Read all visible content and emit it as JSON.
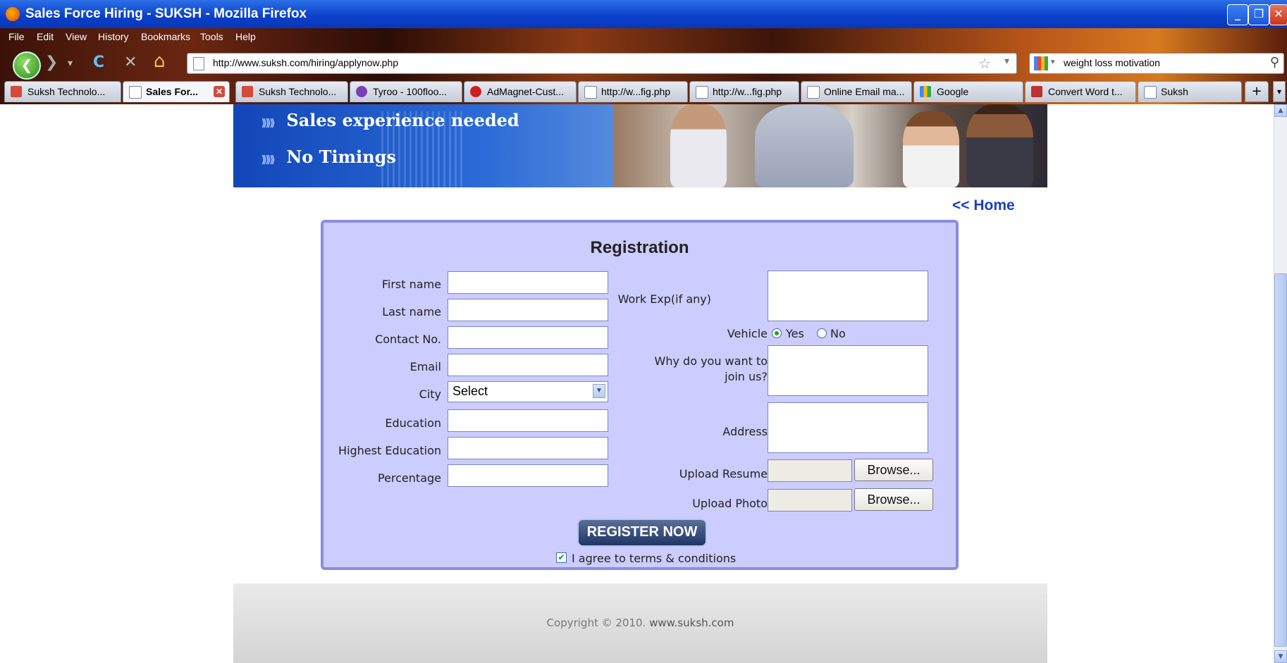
{
  "window": {
    "title": "Sales Force Hiring - SUKSH - Mozilla Firefox",
    "buttons": {
      "minimize": "_",
      "maximize": "❐",
      "close": "✕"
    }
  },
  "menubar": [
    "File",
    "Edit",
    "View",
    "History",
    "Bookmarks",
    "Tools",
    "Help"
  ],
  "toolbar": {
    "url": "http://www.suksh.com/hiring/applynow.php",
    "search_text": "weight loss motivation",
    "back_icon": "back-arrow-icon",
    "reload_glyph": "C",
    "stop_glyph": "✕",
    "home_glyph": "⌂"
  },
  "tabs": [
    {
      "label": "Suksh Technolo...",
      "icon": "gmail-icon",
      "color": "#d44b3a"
    },
    {
      "label": "Sales For...",
      "icon": "page-icon",
      "color": "#ffffff",
      "active": true
    },
    {
      "label": "Suksh Technolo...",
      "icon": "gmail-icon",
      "color": "#d44b3a"
    },
    {
      "label": "Tyroo - 100floo...",
      "icon": "tyroo-icon",
      "color": "#7a3fb5"
    },
    {
      "label": "AdMagnet-Cust...",
      "icon": "admagnet-icon",
      "color": "#cc2020"
    },
    {
      "label": "http://w...fig.php",
      "icon": "page-icon",
      "color": "#ffffff"
    },
    {
      "label": "http://w...fig.php",
      "icon": "page-icon",
      "color": "#ffffff"
    },
    {
      "label": "Online Email ma...",
      "icon": "page-icon",
      "color": "#ffffff"
    },
    {
      "label": "Google",
      "icon": "google-icon",
      "color": "#4285f4"
    },
    {
      "label": "Convert Word t...",
      "icon": "convert-icon",
      "color": "#c03030"
    },
    {
      "label": "Suksh",
      "icon": "page-icon",
      "color": "#ffffff"
    }
  ],
  "new_tab_label": "+",
  "tab_dropdown_label": "▾",
  "banner": {
    "line1": "Sales experience needed",
    "line2": "No Timings",
    "chevron": "⟫⟫⟫"
  },
  "home_link": "<< Home",
  "form": {
    "title": "Registration",
    "left_fields": [
      {
        "label": "First name",
        "type": "text",
        "value": ""
      },
      {
        "label": "Last name",
        "type": "text",
        "value": ""
      },
      {
        "label": "Contact No.",
        "type": "text",
        "value": ""
      },
      {
        "label": "Email",
        "type": "text",
        "value": ""
      },
      {
        "label": "City",
        "type": "select",
        "value": "Select"
      },
      {
        "label": "Education",
        "type": "text",
        "value": ""
      },
      {
        "label": "Highest Education",
        "type": "text",
        "value": ""
      },
      {
        "label": "Percentage",
        "type": "text",
        "value": ""
      }
    ],
    "work_exp_label": "Work Exp(if any)",
    "vehicle_label": "Vehicle",
    "vehicle_yes": "Yes",
    "vehicle_no": "No",
    "vehicle_selected": "Yes",
    "why_label_1": "Why do you want to",
    "why_label_2": "join us?",
    "address_label": "Address",
    "upload_resume_label": "Upload Resume",
    "upload_photo_label": "Upload Photo",
    "browse_label": "Browse...",
    "submit_label": "REGISTER NOW",
    "agree_label": "I agree to terms & conditions",
    "agree_checked": true
  },
  "footer": {
    "copyright": "Copyright © 2010.",
    "site": "www.suksh.com"
  }
}
